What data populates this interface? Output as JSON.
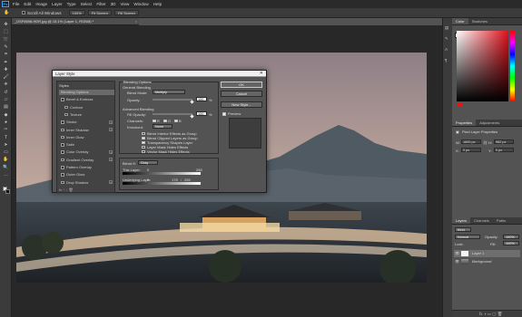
{
  "app": {
    "logo": "Ps"
  },
  "menu": [
    "File",
    "Edit",
    "Image",
    "Layer",
    "Type",
    "Select",
    "Filter",
    "3D",
    "View",
    "Window",
    "Help"
  ],
  "options": {
    "scroll_all": "Scroll All Windows",
    "zoom": "100%",
    "fit": "Fit Screen",
    "fill": "Fill Screen"
  },
  "document": {
    "tab": "_DSF8698-HDR.jpg @ 15.1% (Layer 1, RGB/8) *",
    "close": "×"
  },
  "colors": {
    "accent": "#31a8ff",
    "dialog_bg": "#535353",
    "panel_bg": "#535353",
    "canvas_bg": "#282828"
  },
  "dialog": {
    "title": "Layer Style",
    "close": "✕",
    "list_header": "Styles",
    "styles": [
      {
        "label": "Blending Options",
        "checkbox": false,
        "plus": false,
        "selected": true
      },
      {
        "label": "Bevel & Emboss",
        "checkbox": true,
        "plus": false
      },
      {
        "label": "Contour",
        "checkbox": true,
        "plus": false,
        "indent": true
      },
      {
        "label": "Texture",
        "checkbox": true,
        "plus": false,
        "indent": true
      },
      {
        "label": "Stroke",
        "checkbox": true,
        "plus": true
      },
      {
        "label": "Inner Shadow",
        "checkbox": true,
        "plus": true
      },
      {
        "label": "Inner Glow",
        "checkbox": true,
        "plus": false
      },
      {
        "label": "Satin",
        "checkbox": true,
        "plus": false
      },
      {
        "label": "Color Overlay",
        "checkbox": true,
        "plus": true
      },
      {
        "label": "Gradient Overlay",
        "checkbox": true,
        "plus": true
      },
      {
        "label": "Pattern Overlay",
        "checkbox": true,
        "plus": false
      },
      {
        "label": "Outer Glow",
        "checkbox": true,
        "plus": false
      },
      {
        "label": "Drop Shadow",
        "checkbox": true,
        "plus": true
      }
    ],
    "list_footer": "fx  ↑  ↓  🗑",
    "blending": {
      "legend": "Blending Options",
      "general": "General Blending",
      "blend_mode_label": "Blend Mode:",
      "blend_mode": "Multiply",
      "opacity_label": "Opacity:",
      "opacity": "100",
      "opacity_unit": "%",
      "advanced": "Advanced Blending",
      "fill_label": "Fill Opacity:",
      "fill": "100",
      "fill_unit": "%",
      "channels_label": "Channels:",
      "channels": [
        "R",
        "G",
        "B"
      ],
      "knockout_label": "Knockout:",
      "knockout": "None",
      "options": [
        {
          "label": "Blend Interior Effects as Group",
          "checked": false
        },
        {
          "label": "Blend Clipped Layers as Group",
          "checked": true
        },
        {
          "label": "Transparency Shapes Layer",
          "checked": true
        },
        {
          "label": "Layer Mask Hides Effects",
          "checked": false
        },
        {
          "label": "Vector Mask Hides Effects",
          "checked": false
        }
      ],
      "blend_if_label": "Blend If:",
      "blend_if": "Gray",
      "this_layer": "This Layer:",
      "this_layer_lo": "0",
      "this_layer_hi": "255",
      "underlying": "Underlying Layer:",
      "under_lo": "0",
      "under_mid1": "178",
      "under_mid2": "/",
      "under_mid3": "255"
    },
    "buttons": {
      "ok": "OK",
      "cancel": "Cancel",
      "new_style": "New Style...",
      "preview": "Preview"
    }
  },
  "panels": {
    "color_tabs": [
      "Color",
      "Swatches"
    ],
    "properties_tabs": [
      "Properties",
      "Adjustments"
    ],
    "properties_title": "Pixel Layer Properties",
    "w_label": "W:",
    "w": "1600 px",
    "h_label": "H:",
    "h": "982 px",
    "x_label": "X:",
    "x": "0 px",
    "y_label": "Y:",
    "y": "0 px",
    "layers_tabs": [
      "Layers",
      "Channels",
      "Paths"
    ],
    "kind": "Kind",
    "blend": "Normal",
    "opacity_label": "Opacity:",
    "opacity": "100%",
    "lock": "Lock:",
    "fill_label": "Fill:",
    "fill": "100%",
    "layers": [
      {
        "name": "Layer 1",
        "selected": true
      },
      {
        "name": "Background",
        "selected": false
      }
    ]
  }
}
